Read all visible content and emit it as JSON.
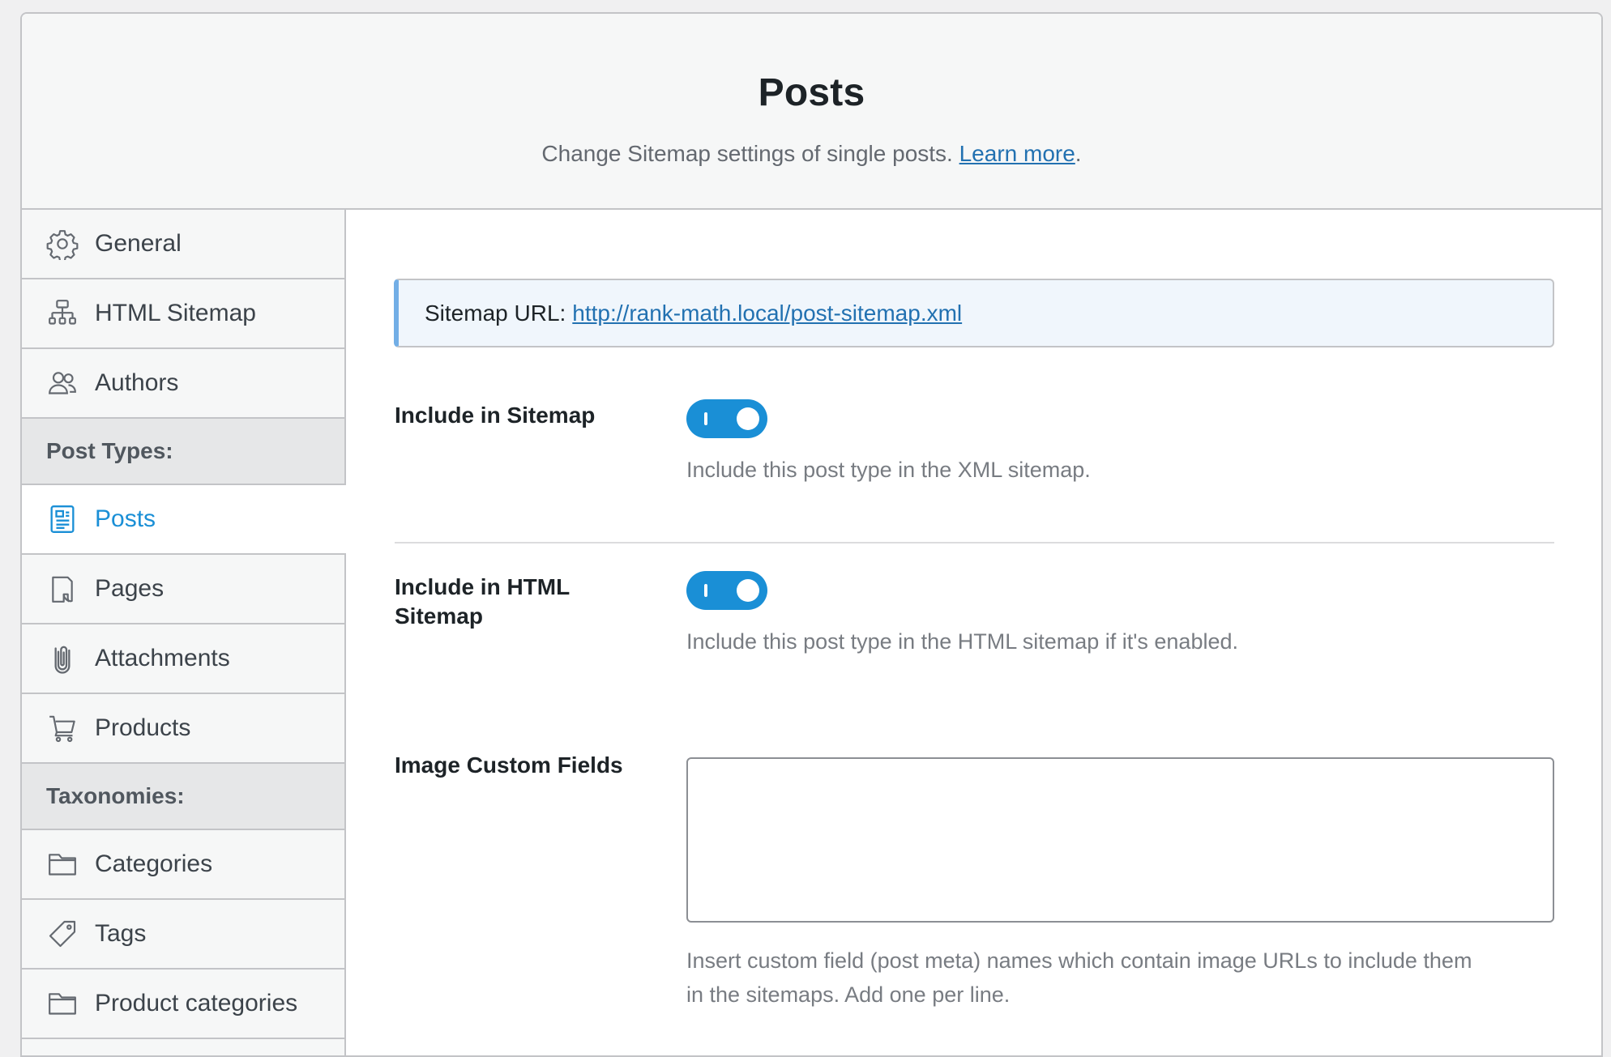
{
  "header": {
    "title": "Posts",
    "subtitle": "Change Sitemap settings of single posts.",
    "learn_more": "Learn more",
    "period": "."
  },
  "sidebar": {
    "items": [
      {
        "label": "General",
        "icon": "gear-icon"
      },
      {
        "label": "HTML Sitemap",
        "icon": "sitemap-icon"
      },
      {
        "label": "Authors",
        "icon": "users-icon"
      }
    ],
    "post_types_heading": "Post Types:",
    "post_types": [
      {
        "label": "Posts",
        "icon": "post-icon",
        "active": true
      },
      {
        "label": "Pages",
        "icon": "page-icon"
      },
      {
        "label": "Attachments",
        "icon": "paperclip-icon"
      },
      {
        "label": "Products",
        "icon": "cart-icon"
      }
    ],
    "taxonomies_heading": "Taxonomies:",
    "taxonomies": [
      {
        "label": "Categories",
        "icon": "folder-icon"
      },
      {
        "label": "Tags",
        "icon": "tag-icon"
      },
      {
        "label": "Product categories",
        "icon": "folder-icon"
      }
    ]
  },
  "main": {
    "sitemap_url_label": "Sitemap URL:",
    "sitemap_url": "http://rank-math.local/post-sitemap.xml",
    "include_sitemap": {
      "label": "Include in Sitemap",
      "enabled": true,
      "description": "Include this post type in the XML sitemap."
    },
    "include_html_sitemap": {
      "label_line1": "Include in HTML",
      "label_line2": "Sitemap",
      "enabled": true,
      "description": "Include this post type in the HTML sitemap if it's enabled."
    },
    "image_custom_fields": {
      "label": "Image Custom Fields",
      "value": "",
      "description_line1": "Insert custom field (post meta) names which contain image URLs to include them",
      "description_line2": "in the sitemaps. Add one per line."
    }
  },
  "colors": {
    "accent": "#1a8fd6",
    "link": "#2271b1",
    "notice_bg": "#f0f6fc",
    "notice_border": "#72aee6"
  }
}
